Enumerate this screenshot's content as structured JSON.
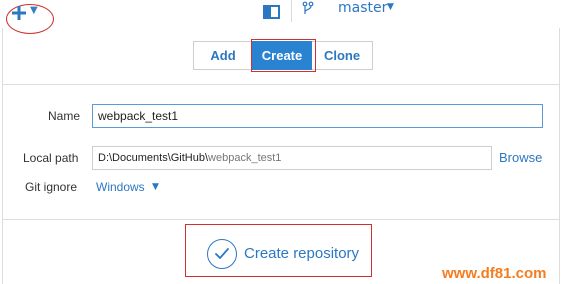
{
  "topbar": {
    "branch": "master"
  },
  "tabs": [
    {
      "label": "Add",
      "active": false
    },
    {
      "label": "Create",
      "active": true
    },
    {
      "label": "Clone",
      "active": false
    }
  ],
  "form": {
    "name_label": "Name",
    "name_value": "webpack_test1",
    "local_path_label": "Local path",
    "local_path_prefix": "D:\\Documents\\GitHub\\",
    "local_path_suffix": "webpack_test1",
    "browse_label": "Browse",
    "gitignore_label": "Git ignore",
    "gitignore_value": "Windows"
  },
  "action": {
    "create_repository_label": "Create repository"
  },
  "watermark": "www.df81.com",
  "colors": {
    "accent": "#2b78c2",
    "active_tab": "#2a83d1",
    "highlight": "#d0302f",
    "watermark": "#f57c1f"
  },
  "icons": {
    "add": "plus-icon",
    "panel_toggle": "sidebar-toggle-icon",
    "branch": "branch-icon",
    "confirm": "check-circle-icon"
  }
}
